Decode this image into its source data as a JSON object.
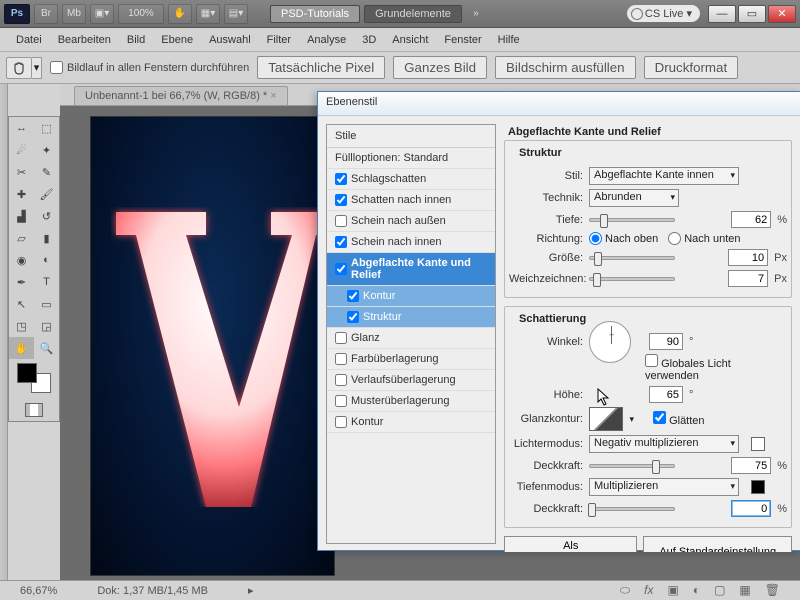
{
  "zoom_label": "100%",
  "titlebar": {
    "tabs": [
      "PSD-Tutorials",
      "Grundelemente"
    ],
    "cs": "CS Live"
  },
  "menu": [
    "Datei",
    "Bearbeiten",
    "Bild",
    "Ebene",
    "Auswahl",
    "Filter",
    "Analyse",
    "3D",
    "Ansicht",
    "Fenster",
    "Hilfe"
  ],
  "options": {
    "scroll_all": "Bildlauf in allen Fenstern durchführen",
    "btns": [
      "Tatsächliche Pixel",
      "Ganzes Bild",
      "Bildschirm ausfüllen",
      "Druckformat"
    ]
  },
  "doc_tab": "Unbenannt-1 bei 66,7% (W, RGB/8) *",
  "status": {
    "zoom": "66,67%",
    "doc": "Dok: 1,37 MB/1,45 MB"
  },
  "dialog": {
    "title": "Ebenenstil",
    "styles_header": "Stile",
    "fill_opts": "Füllloptionen: Standard",
    "items": [
      {
        "label": "Schlagschatten",
        "checked": true
      },
      {
        "label": "Schatten nach innen",
        "checked": true
      },
      {
        "label": "Schein nach außen",
        "checked": false
      },
      {
        "label": "Schein nach innen",
        "checked": true
      },
      {
        "label": "Abgeflachte Kante und Relief",
        "checked": true,
        "active": true
      },
      {
        "label": "Kontur",
        "checked": true,
        "sub": true,
        "activesub": true
      },
      {
        "label": "Struktur",
        "checked": true,
        "sub": true,
        "activesub": true
      },
      {
        "label": "Glanz",
        "checked": false
      },
      {
        "label": "Farbüberlagerung",
        "checked": false
      },
      {
        "label": "Verlaufsüberlagerung",
        "checked": false
      },
      {
        "label": "Musterüberlagerung",
        "checked": false
      },
      {
        "label": "Kontur",
        "checked": false
      }
    ],
    "panel": {
      "title": "Abgeflachte Kante und Relief",
      "struct": "Struktur",
      "style_lbl": "Stil:",
      "style_val": "Abgeflachte Kante innen",
      "tech_lbl": "Technik:",
      "tech_val": "Abrunden",
      "depth_lbl": "Tiefe:",
      "depth_val": "62",
      "depth_unit": "%",
      "dir_lbl": "Richtung:",
      "dir_up": "Nach oben",
      "dir_down": "Nach unten",
      "size_lbl": "Größe:",
      "size_val": "10",
      "size_unit": "Px",
      "soft_lbl": "Weichzeichnen:",
      "soft_val": "7",
      "soft_unit": "Px",
      "shade": "Schattierung",
      "angle_lbl": "Winkel:",
      "angle_val": "90",
      "deg": "°",
      "global": "Globales Licht verwenden",
      "alt_lbl": "Höhe:",
      "alt_val": "65",
      "gloss_lbl": "Glanzkontur:",
      "smooth": "Glätten",
      "light_mode_lbl": "Lichtermodus:",
      "light_mode_val": "Negativ multiplizieren",
      "opacity_lbl": "Deckkraft:",
      "opacity1": "75",
      "shadow_mode_lbl": "Tiefenmodus:",
      "shadow_mode_val": "Multiplizieren",
      "opacity2": "0",
      "btn_default": "Als Standardeinstellung festlegen",
      "btn_reset": "Auf Standardeinstellung zurücksetzen"
    }
  }
}
